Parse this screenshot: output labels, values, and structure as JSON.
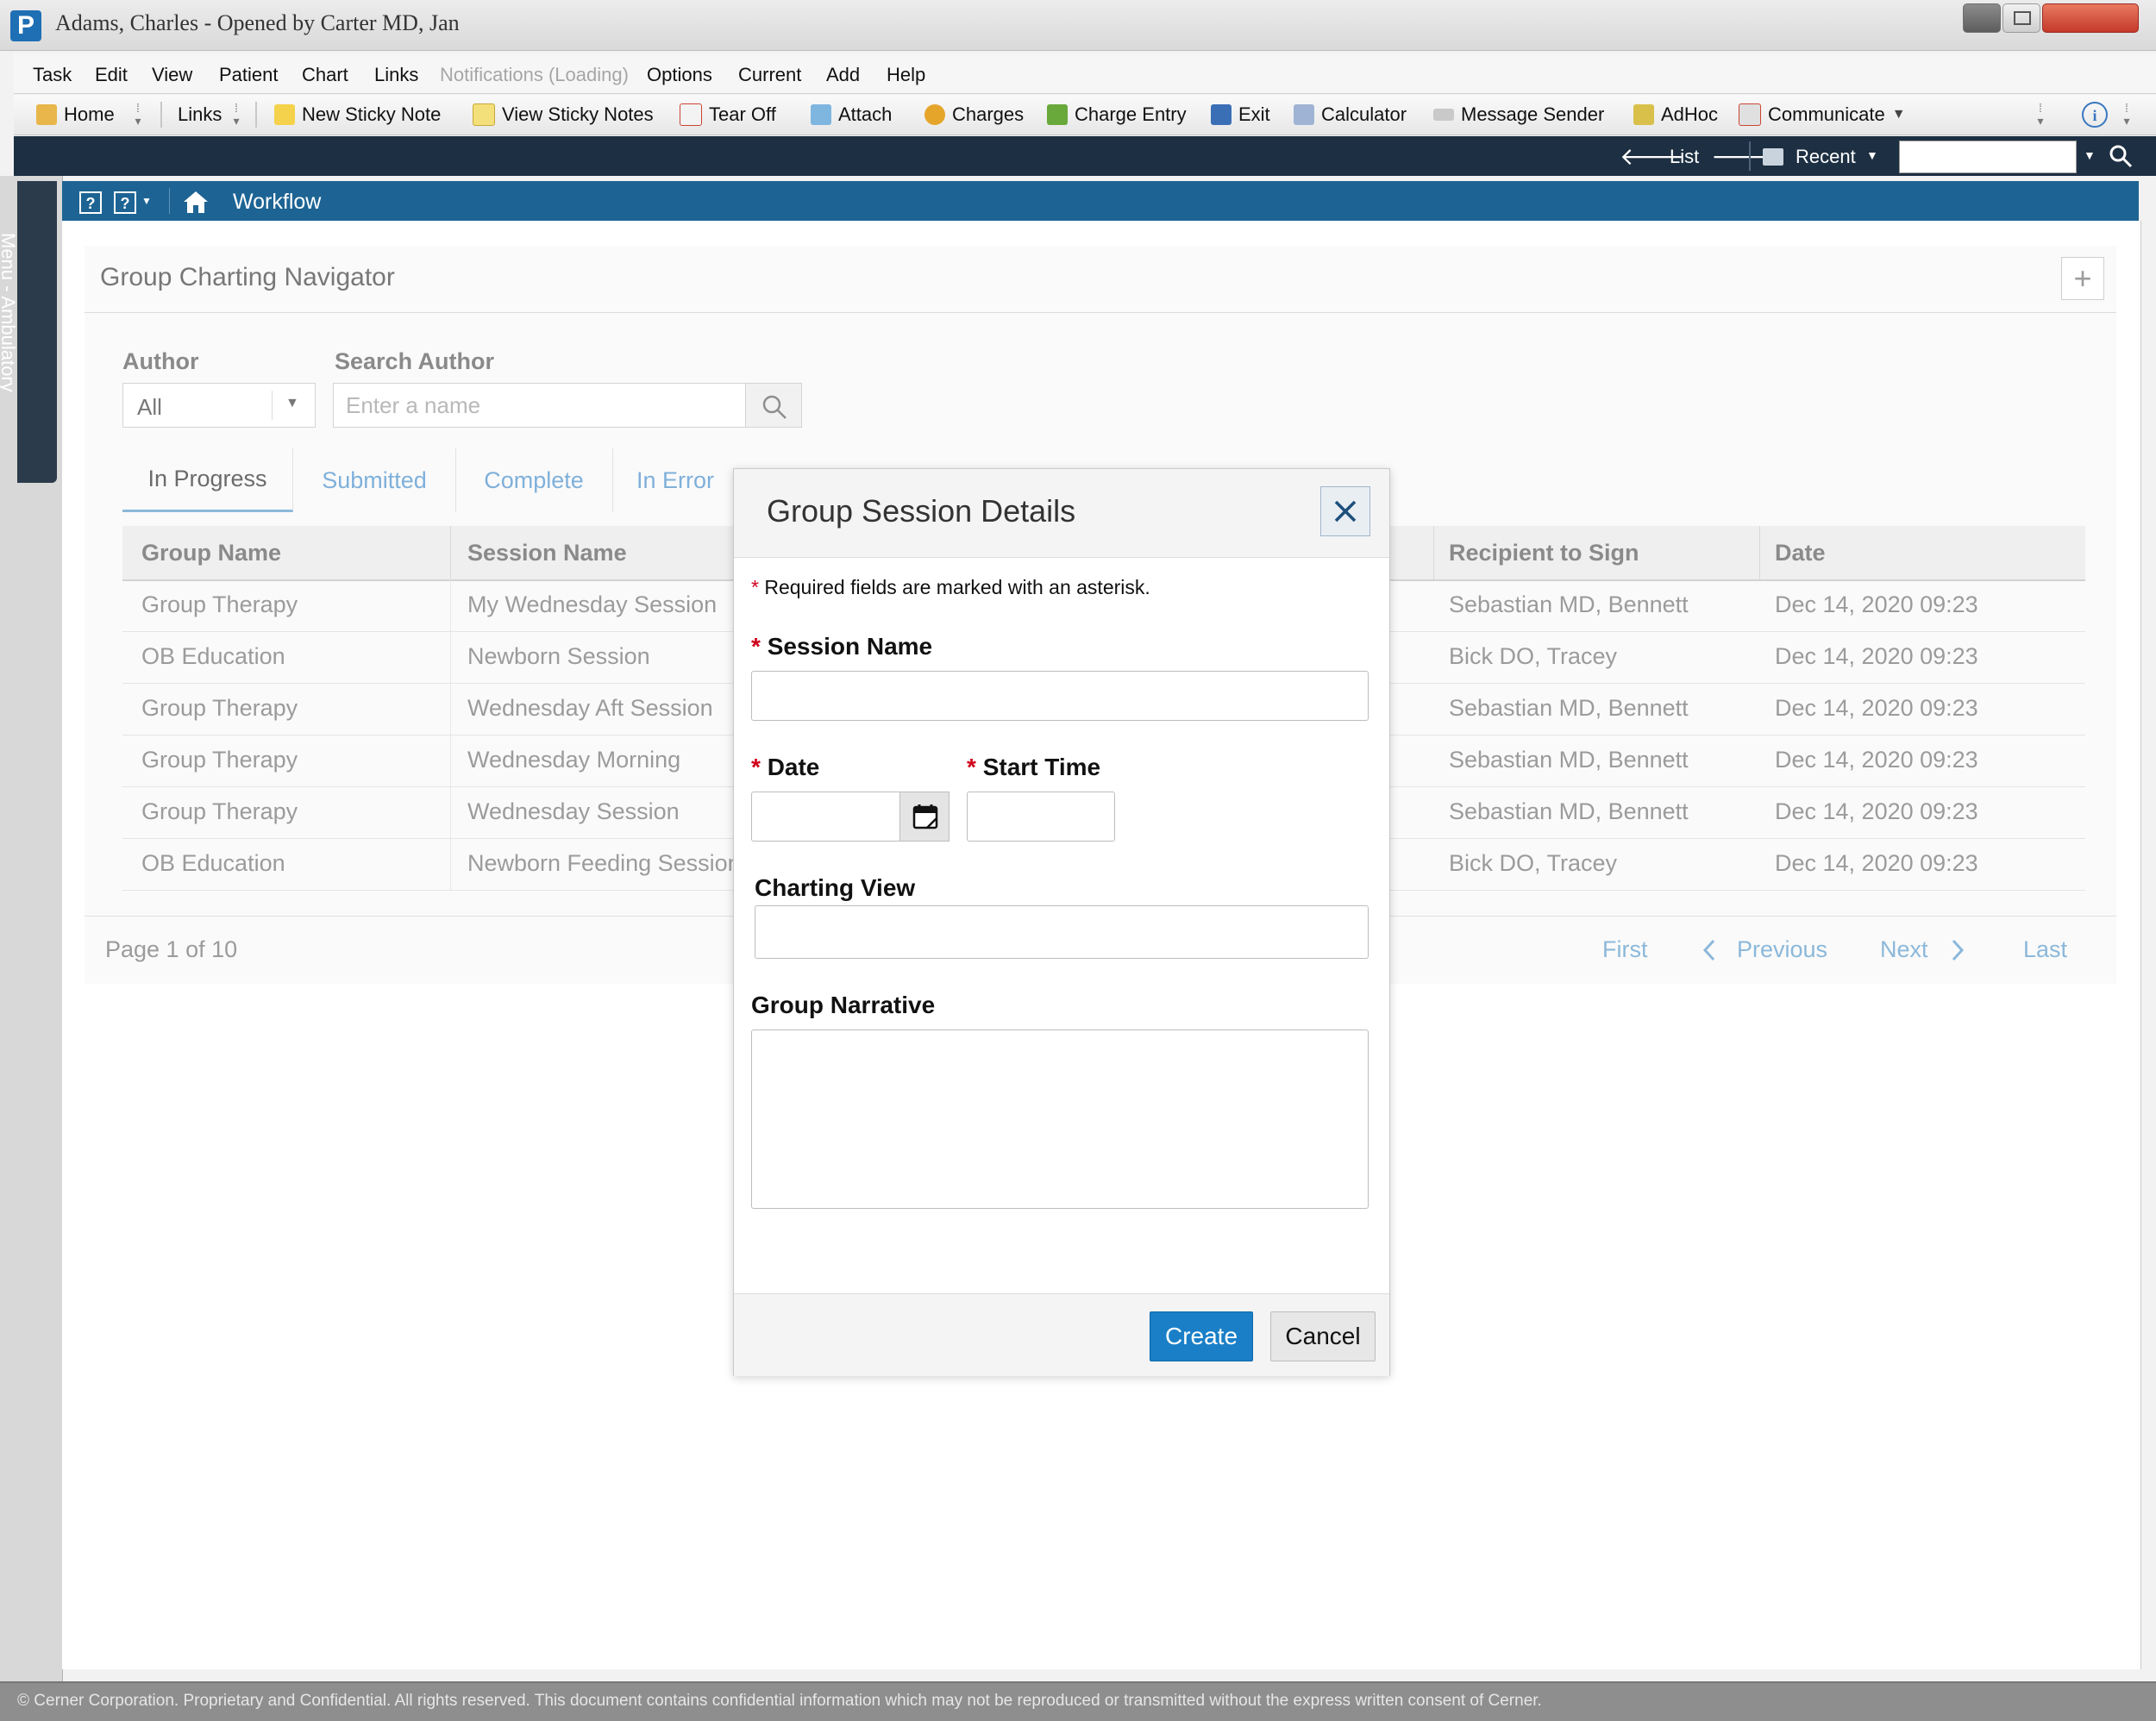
{
  "window": {
    "title": "Adams, Charles - Opened by Carter MD, Jan",
    "logo_letter": "P"
  },
  "menu": [
    "Task",
    "Edit",
    "View",
    "Patient",
    "Chart",
    "Links",
    "Notifications (Loading)",
    "Options",
    "Current",
    "Add",
    "Help"
  ],
  "toolbar": {
    "home": "Home",
    "links": "Links",
    "new_sticky": "New Sticky Note",
    "view_sticky": "View Sticky Notes",
    "tear_off": "Tear Off",
    "attach": "Attach",
    "charges": "Charges",
    "charge_entry": "Charge Entry",
    "exit": "Exit",
    "calculator": "Calculator",
    "message_sender": "Message Sender",
    "adhoc": "AdHoc",
    "communicate": "Communicate"
  },
  "nav": {
    "list": "List",
    "recent": "Recent"
  },
  "sidebar": {
    "tab_label": "Menu - Ambulatory"
  },
  "workflow": {
    "label": "Workflow",
    "help1": "?",
    "help2": "?"
  },
  "navigator": {
    "title": "Group Charting Navigator",
    "add_symbol": "+",
    "author_label": "Author",
    "author_value": "All",
    "search_author_label": "Search Author",
    "search_placeholder": "Enter a name",
    "tabs": [
      "In Progress",
      "Submitted",
      "Complete",
      "In Error"
    ],
    "columns": {
      "group_name": "Group Name",
      "session_name": "Session Name",
      "recipient": "Recipient to Sign",
      "date": "Date"
    },
    "rows": [
      {
        "group": "Group Therapy",
        "session": "My Wednesday Session",
        "recipient": "Sebastian MD, Bennett",
        "date": "Dec 14, 2020 09:23"
      },
      {
        "group": "OB Education",
        "session": "Newborn Session",
        "recipient": "Bick DO, Tracey",
        "date": "Dec 14, 2020 09:23"
      },
      {
        "group": "Group Therapy",
        "session": "Wednesday Aft Session",
        "recipient": "Sebastian MD, Bennett",
        "date": "Dec 14, 2020 09:23"
      },
      {
        "group": "Group Therapy",
        "session": "Wednesday Morning",
        "recipient": "Sebastian MD, Bennett",
        "date": "Dec 14, 2020 09:23"
      },
      {
        "group": "Group Therapy",
        "session": "Wednesday Session",
        "recipient": "Sebastian MD, Bennett",
        "date": "Dec 14, 2020 09:23"
      },
      {
        "group": "OB Education",
        "session": "Newborn Feeding Session",
        "recipient": "Bick DO, Tracey",
        "date": "Dec 14, 2020 09:23"
      }
    ],
    "pager": {
      "page_text": "Page 1 of 10",
      "first": "First",
      "previous": "Previous",
      "next": "Next",
      "last": "Last"
    }
  },
  "modal": {
    "title": "Group Session Details",
    "required_note": "Required fields are marked with an asterisk.",
    "asterisk": "*",
    "session_name_label": "Session Name",
    "session_name_value": "",
    "date_label": "Date",
    "date_value": "",
    "start_time_label": "Start Time",
    "start_time_value": "",
    "charting_view_label": "Charting View",
    "charting_view_value": "",
    "group_narrative_label": "Group Narrative",
    "group_narrative_value": "",
    "create_label": "Create",
    "cancel_label": "Cancel"
  },
  "footer": {
    "copyright": "© Cerner Corporation. Proprietary and Confidential. All rights reserved. This document contains confidential information which may not be reproduced or transmitted without the express written consent of Cerner."
  },
  "colors": {
    "nav_dark": "#1d2f42",
    "workflow_blue": "#1d6494",
    "link_blue": "#8bb8da",
    "primary_button": "#1a7fc7",
    "required_red": "#d0021b"
  }
}
